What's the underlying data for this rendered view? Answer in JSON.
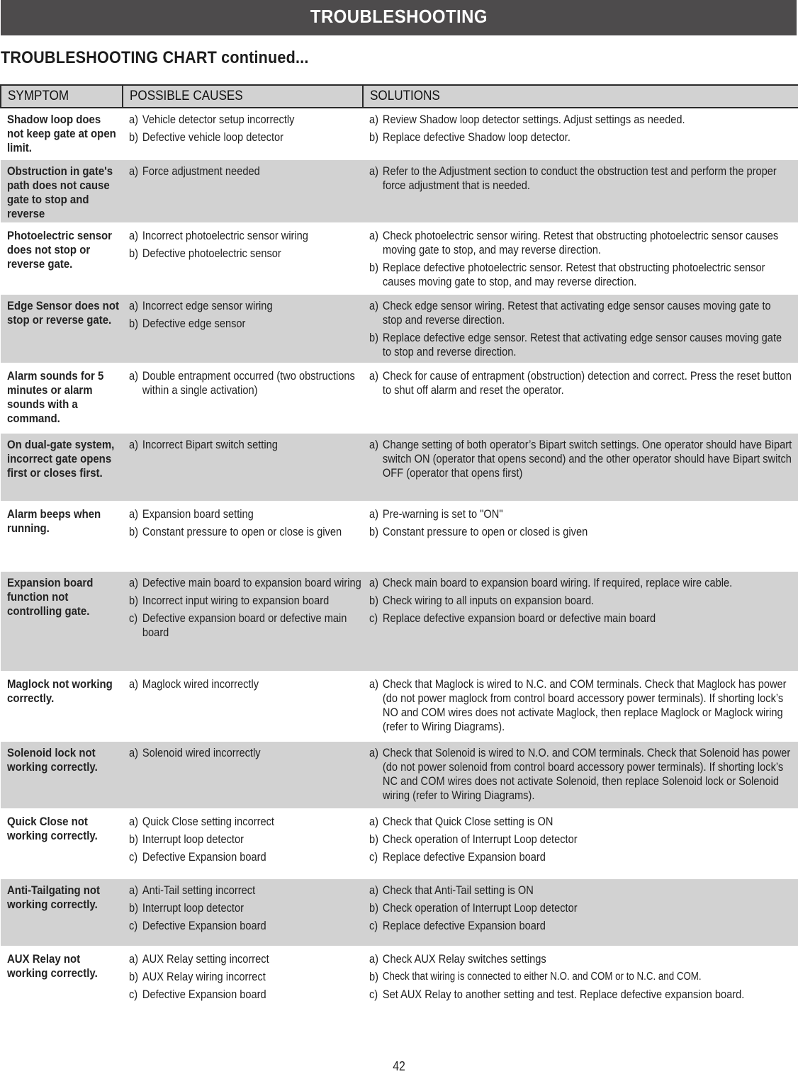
{
  "banner_title": "TROUBLESHOOTING",
  "subtitle": "TROUBLESHOOTING CHART continued...",
  "table": {
    "headers": [
      "SYMPTOM",
      "POSSIBLE CAUSES",
      "SOLUTIONS"
    ],
    "rows": [
      {
        "symptom": "Shadow loop does not keep gate at open limit.",
        "causes": [
          {
            "label": "a)",
            "text": "Vehicle detector setup incorrectly"
          },
          {
            "label": "b)",
            "text": "Defective vehicle loop detector"
          }
        ],
        "solutions": [
          {
            "label": "a)",
            "text": "Review Shadow loop detector settings. Adjust settings as needed."
          },
          {
            "label": "b)",
            "text": "Replace defective Shadow loop detector."
          }
        ]
      },
      {
        "symptom": "Obstruction in gate's path does not cause gate to stop and reverse",
        "causes": [
          {
            "label": "a)",
            "text": "Force adjustment needed"
          }
        ],
        "solutions": [
          {
            "label": "a)",
            "text": "Refer to the Adjustment section to conduct the obstruction test and perform the proper force adjustment that is needed."
          }
        ]
      },
      {
        "symptom": "Photoelectric sensor does not stop or reverse gate.",
        "causes": [
          {
            "label": "a)",
            "text": "Incorrect photoelectric sensor wiring"
          },
          {
            "label": "b)",
            "text": "Defective photoelectric sensor"
          }
        ],
        "solutions": [
          {
            "label": "a)",
            "text": "Check photoelectric sensor wiring. Retest that obstructing photoelectric sensor causes moving gate to stop, and may reverse direction."
          },
          {
            "label": "b)",
            "text": "Replace defective photoelectric sensor. Retest that obstructing photoelectric sensor causes moving gate to stop, and may reverse direction."
          }
        ]
      },
      {
        "symptom": "Edge Sensor does not stop or reverse gate.",
        "causes": [
          {
            "label": "a)",
            "text": "Incorrect edge sensor wiring"
          },
          {
            "label": "b)",
            "text": "Defective edge sensor"
          }
        ],
        "solutions": [
          {
            "label": "a)",
            "text": "Check edge sensor wiring. Retest that activating edge sensor causes moving gate to stop and reverse direction."
          },
          {
            "label": "b)",
            "text": "Replace defective edge sensor. Retest that activating edge sensor causes moving gate to stop and reverse direction."
          }
        ]
      },
      {
        "symptom": "Alarm sounds for 5 minutes or alarm sounds with a command.",
        "causes": [
          {
            "label": "a)",
            "text": "Double entrapment occurred (two obstructions within a single activation)"
          }
        ],
        "solutions": [
          {
            "label": "a)",
            "text": "Check for cause of entrapment (obstruction) detection and correct. Press the reset button to shut off alarm and reset the operator."
          }
        ]
      },
      {
        "symptom": "On dual-gate system, incorrect gate opens first or closes first.",
        "causes": [
          {
            "label": "a)",
            "text": "Incorrect Bipart switch setting"
          }
        ],
        "solutions": [
          {
            "label": "a)",
            "text": "Change setting of both operator’s Bipart switch settings. One operator should have Bipart switch ON (operator that opens second) and the other operator should have Bipart switch OFF (operator that opens first)"
          }
        ]
      },
      {
        "symptom": "Alarm beeps when running.",
        "causes": [
          {
            "label": "a)",
            "text": "Expansion board setting"
          },
          {
            "label": "b)",
            "text": "Constant pressure to open or close is given"
          }
        ],
        "solutions": [
          {
            "label": "a)",
            "text": "Pre-warning is set to \"ON\""
          },
          {
            "label": "b)",
            "text": "Constant pressure to open or closed is given"
          }
        ]
      },
      {
        "symptom": "Expansion board function not controlling gate.",
        "causes": [
          {
            "label": "a)",
            "text": "Defective main board to expansion board wiring"
          },
          {
            "label": "b)",
            "text": "Incorrect input wiring to expansion board"
          },
          {
            "label": "c)",
            "text": "Defective expansion board or defective main board"
          }
        ],
        "solutions": [
          {
            "label": "a)",
            "text": "Check main board to expansion board wiring. If required, replace wire cable."
          },
          {
            "label": "b)",
            "text": "Check wiring to all inputs on expansion board."
          },
          {
            "label": "c)",
            "text": "Replace defective expansion board or defective main board"
          }
        ]
      },
      {
        "symptom": "Maglock not working correctly.",
        "causes": [
          {
            "label": "a)",
            "text": "Maglock wired incorrectly"
          }
        ],
        "solutions": [
          {
            "label": "a)",
            "text": "Check that Maglock is wired to N.C. and COM terminals. Check that Maglock has power (do not power maglock from control board accessory power terminals). If shorting lock’s NO and COM wires does not activate Maglock, then replace Maglock or Maglock wiring (refer to Wiring Diagrams)."
          }
        ]
      },
      {
        "symptom": "Solenoid lock not working correctly.",
        "causes": [
          {
            "label": "a)",
            "text": "Solenoid wired incorrectly"
          }
        ],
        "solutions": [
          {
            "label": "a)",
            "text": "Check that Solenoid is wired to N.O. and COM terminals. Check that Solenoid has power (do not power solenoid from control board accessory power terminals). If shorting lock’s NC and COM wires does not activate Solenoid, then replace Solenoid lock or Solenoid wiring (refer to Wiring Diagrams)."
          }
        ]
      },
      {
        "symptom": "Quick Close not working correctly.",
        "causes": [
          {
            "label": "a)",
            "text": "Quick Close setting incorrect"
          },
          {
            "label": "b)",
            "text": "Interrupt loop detector"
          },
          {
            "label": "c)",
            "text": "Defective Expansion board"
          }
        ],
        "solutions": [
          {
            "label": "a)",
            "text": "Check that Quick Close setting is ON"
          },
          {
            "label": "b)",
            "text": "Check operation of Interrupt Loop detector"
          },
          {
            "label": "c)",
            "text": "Replace defective Expansion board"
          }
        ]
      },
      {
        "symptom": "Anti-Tailgating not working correctly.",
        "causes": [
          {
            "label": "a)",
            "text": "Anti-Tail setting incorrect"
          },
          {
            "label": "b)",
            "text": "Interrupt loop detector"
          },
          {
            "label": "c)",
            "text": "Defective Expansion board"
          }
        ],
        "solutions": [
          {
            "label": "a)",
            "text": "Check that Anti-Tail setting is ON"
          },
          {
            "label": "b)",
            "text": "Check operation of Interrupt Loop detector"
          },
          {
            "label": "c)",
            "text": "Replace defective Expansion board"
          }
        ]
      },
      {
        "symptom": "AUX Relay not working correctly.",
        "causes": [
          {
            "label": "a)",
            "text": "AUX Relay setting incorrect"
          },
          {
            "label": "b)",
            "text": "AUX Relay wiring incorrect"
          },
          {
            "label": "c)",
            "text": "Defective Expansion board"
          }
        ],
        "solutions": [
          {
            "label": "a)",
            "text": "Check AUX Relay switches settings"
          },
          {
            "label": "b)",
            "text": "Check that wiring is connected to either N.O. and COM or to N.C. and COM."
          },
          {
            "label": "c)",
            "text": "Set AUX Relay to another setting and test. Replace defective expansion board."
          }
        ]
      }
    ]
  },
  "page_number": "42",
  "colors": {
    "banner_bg": "#4d4b4c",
    "row_shade": "#d2d2d2",
    "text": "#1f1f1f"
  }
}
